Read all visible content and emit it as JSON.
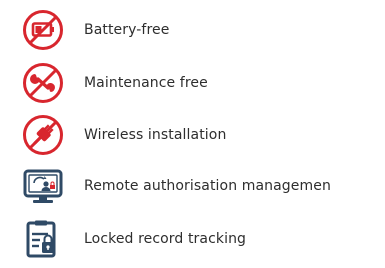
{
  "colors": {
    "accent": "#d8262e",
    "secondary": "#2f4a66"
  },
  "features": [
    {
      "icon": "battery-crossed-icon",
      "label": "Battery-free"
    },
    {
      "icon": "wrench-crossed-icon",
      "label": "Maintenance free"
    },
    {
      "icon": "plug-crossed-icon",
      "label": "Wireless installation"
    },
    {
      "icon": "remote-management-monitor-icon",
      "label": "Remote authorisation managemen"
    },
    {
      "icon": "locked-record-clipboard-icon",
      "label": "Locked record tracking"
    }
  ]
}
